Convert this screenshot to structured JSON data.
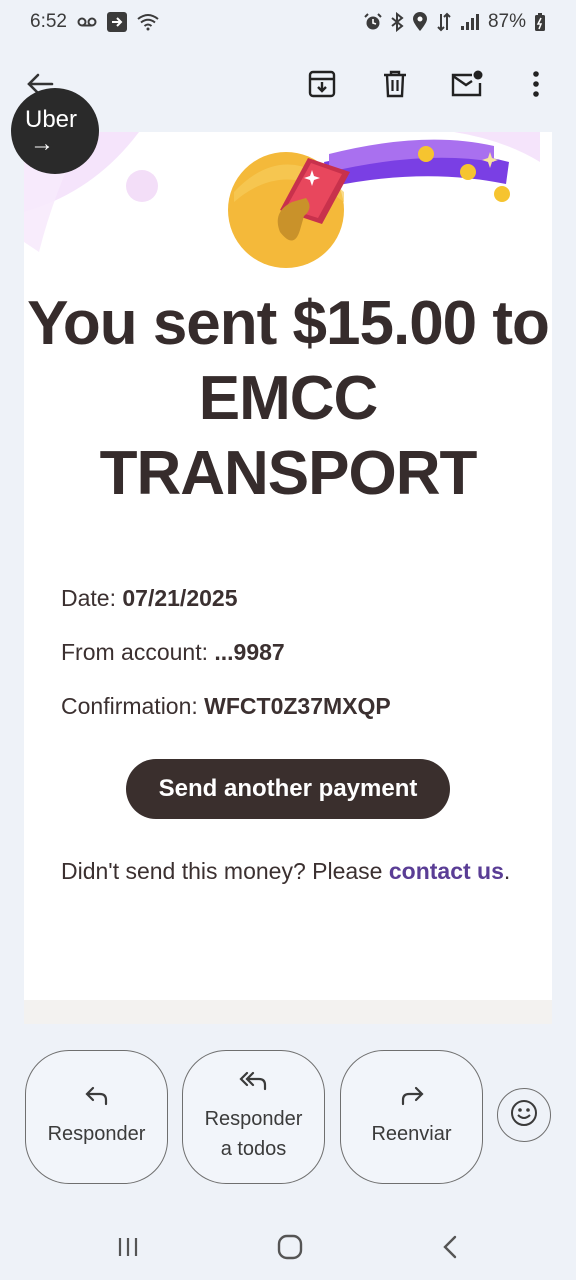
{
  "status_bar": {
    "time": "6:52",
    "battery": "87%"
  },
  "toolbar": {
    "icons": [
      "back-arrow-icon",
      "archive-icon",
      "delete-icon",
      "mark-unread-icon",
      "more-vert-icon"
    ]
  },
  "overlay": {
    "app_name": "Uber",
    "arrow": "→"
  },
  "email": {
    "headline": "You sent $15.00 to EMCC TRANSPORT",
    "date_label": "Date:",
    "date_value": "07/21/2025",
    "account_label": "From account:",
    "account_value": "...9987",
    "confirmation_label": "Confirmation:",
    "confirmation_value": "WFCT0Z37MXQP",
    "button_label": "Send another payment",
    "notice_text": "Didn't send this money? Please ",
    "notice_link": "contact us",
    "notice_end": "."
  },
  "actions": {
    "reply": "Responder",
    "reply_all_line1": "Responder",
    "reply_all_line2": "a todos",
    "forward": "Reenviar"
  },
  "colors": {
    "accent_purple": "#7a3fe4",
    "link": "#5a3d95",
    "button_bg": "#3a2f2d"
  }
}
